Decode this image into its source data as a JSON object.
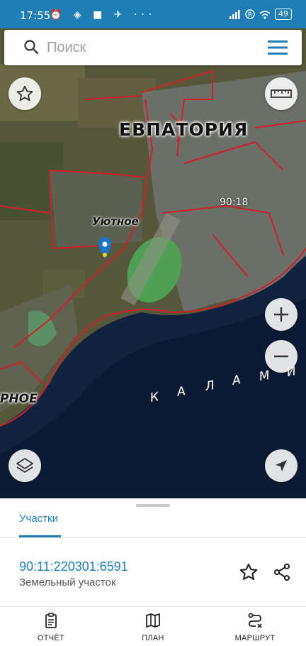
{
  "status_bar": {
    "time": "17:55",
    "battery": "49"
  },
  "search": {
    "placeholder": "Поиск"
  },
  "map": {
    "city_label": "ЕВПАТОРИЯ",
    "village_label": "Уютное",
    "left_label": "РНОЕ",
    "parcel_code": "90:18",
    "bay_letters": [
      "К",
      "А",
      "Л",
      "А",
      "М",
      "И"
    ]
  },
  "sheet": {
    "tab": "Участки",
    "parcel_id": "90:11:220301:6591",
    "parcel_type": "Земельный участок"
  },
  "nav": {
    "report": "ОТЧЁТ",
    "plan": "ПЛАН",
    "route": "МАРШРУТ"
  }
}
